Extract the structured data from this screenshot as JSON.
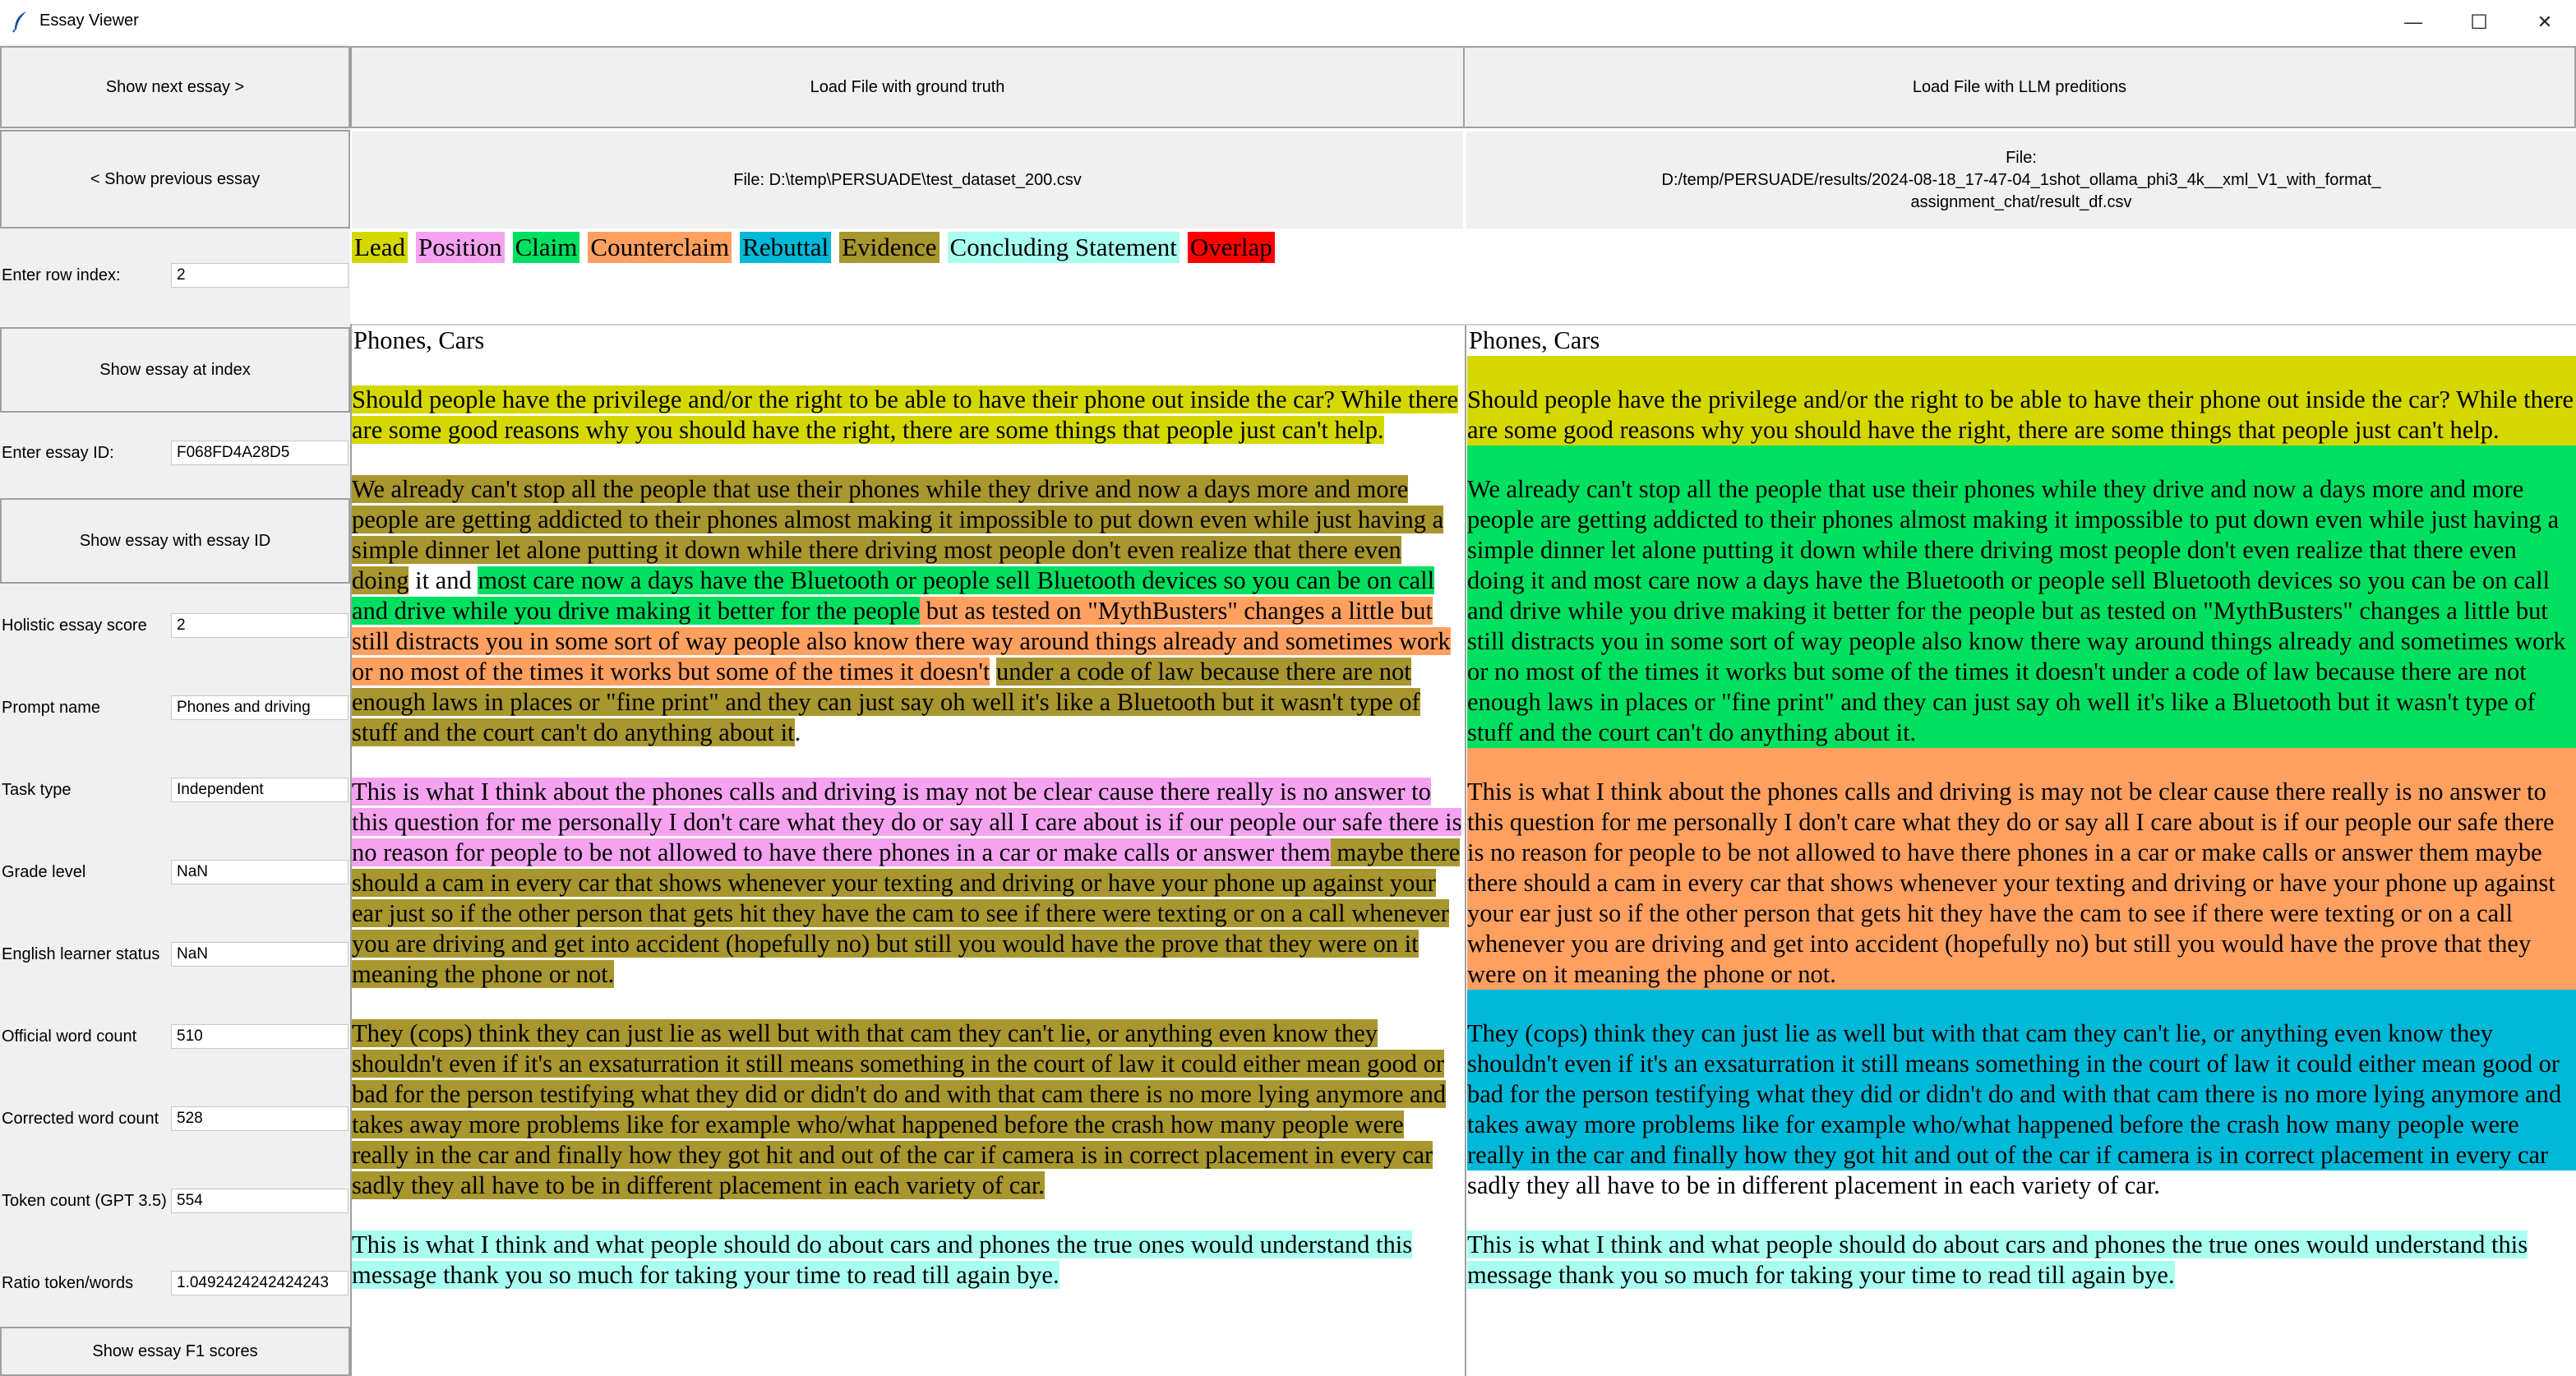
{
  "window": {
    "title": "Essay Viewer",
    "minimize": "—",
    "maximize": "☐",
    "close": "✕"
  },
  "buttons": {
    "next": "Show next essay >",
    "prev": "< Show previous essay",
    "at_index": "Show essay at index",
    "with_id": "Show essay with essay ID",
    "f1": "Show essay F1 scores",
    "load_truth": "Load File with ground truth",
    "load_llm": "Load File with LLM preditions"
  },
  "files": {
    "truth": "File: D:\\temp\\PERSUADE\\test_dataset_200.csv",
    "llm_line1": "File:",
    "llm_line2": "D:/temp/PERSUADE/results/2024-08-18_17-47-04_1shot_ollama_phi3_4k__xml_V1_with_format_",
    "llm_line3": "assignment_chat/result_df.csv"
  },
  "fields": [
    {
      "label": "Enter row index:",
      "value": "2"
    },
    {
      "label": "Enter essay ID:",
      "value": "F068FD4A28D5"
    },
    {
      "label": "Holistic essay score",
      "value": "2"
    },
    {
      "label": "Prompt name",
      "value": "Phones and driving"
    },
    {
      "label": "Task type",
      "value": "Independent"
    },
    {
      "label": "Grade level",
      "value": "NaN"
    },
    {
      "label": "English learner status",
      "value": "NaN"
    },
    {
      "label": "Official word count",
      "value": "510"
    },
    {
      "label": "Corrected word count",
      "value": "528"
    },
    {
      "label": "Token count (GPT 3.5)",
      "value": "554"
    },
    {
      "label": "Ratio token/words",
      "value": "1.0492424242424243"
    }
  ],
  "legend": [
    "Lead",
    "Position",
    "Claim",
    "Counterclaim",
    "Rebuttal",
    "Evidence",
    "Concluding Statement",
    "Overlap"
  ],
  "colors": {
    "lead": "#d4d800",
    "position": "#f5a3f0",
    "claim": "#00e060",
    "counterclaim": "#ffa060",
    "rebuttal": "#00b8d8",
    "evidence": "#a8962e",
    "concluding": "#a8fff0",
    "overlap": "#ff0000"
  },
  "essay_title": "Phones, Cars",
  "ground_truth": {
    "p1": {
      "lead": "Should people have the privilege and/or the right to be able to have their phone out inside the car? While there are some good reasons why you should have the right, there are some things that people just can't help."
    },
    "p2": {
      "evidence1": "We already can't stop all the people that use their phones while they drive and now a days more and more people are getting addicted to their phones almost making it impossible to put down even while just having a simple dinner let alone putting it down while there driving most people don't even realize that there even doing",
      "plain1": " it and ",
      "claim": "most care now a days have the Bluetooth or people sell Bluetooth devices so you can be on call and drive while you drive making it better for the people",
      "counter": " but as tested on \"MythBusters\" changes a little but still distracts you in some sort of way people also know there way around things already and sometimes work or no most of the times it works but some of the times it doesn't",
      "plain2": " ",
      "evidence2": "under a code of law because there are not enough laws in places or \"fine print\" and they can just say oh well it's like a Bluetooth but it wasn't type of stuff and the court can't do anything about it",
      "plain3": "."
    },
    "p3": {
      "position": "This is what I think about the phones calls and driving is may not be clear cause there really is no answer to this question for me personally I don't care what they do or say all I care about is if our people our safe there is no reason for people to be not allowed to have there phones in a car or make calls or answer them",
      "evidence": " maybe there should a cam in every car that shows whenever your texting and driving or have your phone up against your ear just so if the other person that gets hit they have the cam to see if there were texting or on a call whenever you are driving and get into accident (hopefully no) but still you would have the prove that they were on it meaning the phone or not."
    },
    "p4": {
      "evidence": "They (cops) think they can just lie as well but with that cam they can't lie, or anything even know they shouldn't even if it's an exsaturration it still means something in the court of law it could either mean good or bad for the person testifying what they did or didn't do and with that cam there is no more lying anymore and takes away more problems like for example who/what happened before the crash how many people were really in the car and finally how they got hit and out of the car if camera is in correct placement in every car sadly they all have to be in different placement in each variety of car.",
      "plain": ""
    },
    "p5": {
      "concluding": "This is what I think and what people should do about cars and phones the true ones would understand this message thank you so much for taking your time to read till again bye."
    }
  },
  "llm": {
    "p1": {
      "lead": "Should people have the privilege and/or the right to be able to have their phone out inside the car? While there are some good reasons why you should have the right, there are some things that people just can't help."
    },
    "p2": {
      "claim": "We already can't stop all the people that use their phones while they drive and now a days more and more people are getting addicted to their phones almost making it impossible to put down even while just having a simple dinner let alone putting it down while there driving most people don't even realize that there even doing it and most care now a days have the Bluetooth or people sell Bluetooth devices so you can be on call and drive while you drive making it better for the people but as tested on \"MythBusters\" changes a little but still distracts you in some sort of way people also know there way around things already and sometimes work or no most of the times it works but some of the times it doesn't under a code of law because there are not enough laws in places or \"fine print\" and they can just say oh well it's like a Bluetooth but it wasn't type of stuff and the court can't do anything about it."
    },
    "p3": {
      "counter": "This is what I think about the phones calls and driving is may not be clear cause there really is no answer to this question for me personally I don't care what they do or say all I care about is if our people our safe there is no reason for people to be not allowed to have there phones in a car or make calls or answer them maybe there should a cam in every car that shows whenever your texting and driving or have your phone up against your ear just so if the other person that gets hit they have the cam to see if there were texting or on a call whenever you are driving and get into accident (hopefully no) but still you would have the prove that they were on it meaning the phone or not."
    },
    "p4": {
      "rebuttal": "They (cops) think they can just lie as well but with that cam they can't lie, or anything even know they shouldn't even if it's an exsaturration it still means something in the court of law it could either mean good or bad for the person testifying what they did or didn't do and with that cam there is no more lying anymore and takes away more problems like for example who/what happened before the crash how many people were really in the car and finally how they got hit and out of the car if camera is in correct placement in every car",
      "plain": " sadly they all have to be in different placement in each variety of car."
    },
    "p5": {
      "concluding": "This is what I think and what people should do about cars and phones the true ones would understand this message thank you so much for taking your time to read till again bye."
    }
  }
}
